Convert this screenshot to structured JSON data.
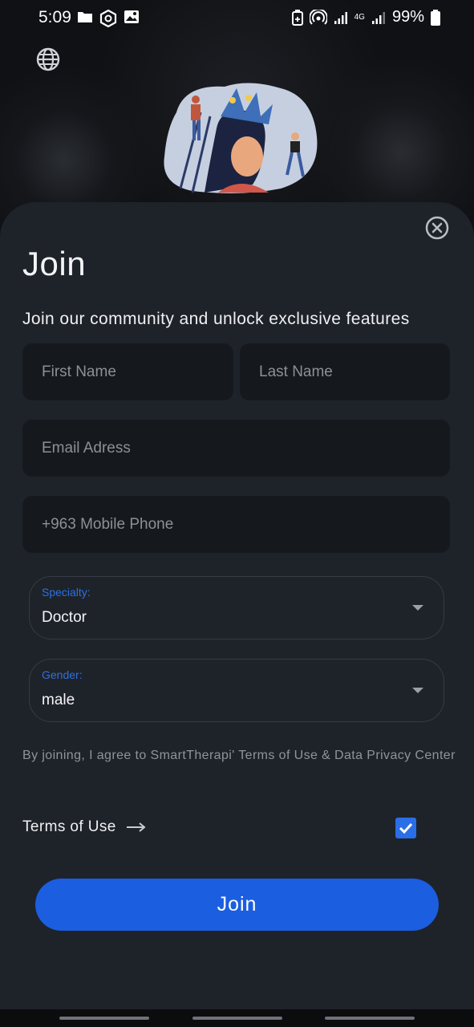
{
  "status_bar": {
    "time": "5:09",
    "battery": "99%",
    "network": "4G",
    "left_icons": [
      "folder-icon",
      "hexagon-icon",
      "image-icon"
    ],
    "right_icons": [
      "battery-saver-icon",
      "hotspot-icon",
      "signal-icon",
      "signal-icon",
      "battery-icon"
    ]
  },
  "header": {
    "language_icon": "globe-icon",
    "illustration": "person-head-plants-illustration"
  },
  "sheet": {
    "close_icon": "close-circle-icon",
    "title": "Join",
    "subtitle": "Join our community and unlock exclusive features"
  },
  "form": {
    "first_name": {
      "placeholder": "First Name",
      "value": ""
    },
    "last_name": {
      "placeholder": "Last Name",
      "value": ""
    },
    "email": {
      "placeholder": "Email Adress",
      "value": ""
    },
    "phone": {
      "placeholder": "+963 Mobile Phone",
      "value": ""
    },
    "specialty": {
      "label": "Specialty:",
      "value": "Doctor"
    },
    "gender": {
      "label": "Gender:",
      "value": "male"
    },
    "agreement_text": "By joining, I agree to SmartTherapi' Terms of Use & Data Privacy Center",
    "terms_label": "Terms of Use",
    "terms_checked": true,
    "join_label": "Join"
  },
  "colors": {
    "accent": "#1b5ee0",
    "sheet_bg": "#1e232a",
    "field_bg": "#15191e",
    "label_blue": "#2f6fe0"
  }
}
